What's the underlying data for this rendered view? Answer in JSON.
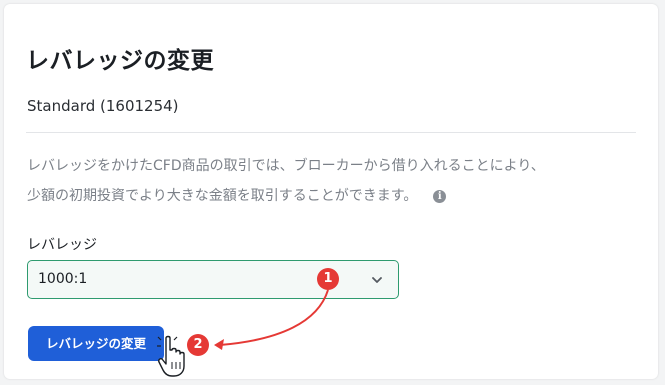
{
  "dialog": {
    "title": "レバレッジの変更",
    "account": "Standard (1601254)",
    "description_line1": "レバレッジをかけたCFD商品の取引では、ブローカーから借り入れることにより、",
    "description_line2": "少額の初期投資でより大きな金額を取引することができます。",
    "info_icon": "info-icon",
    "leverage_label": "レバレッジ",
    "leverage_value": "1000:1",
    "submit_label": "レバレッジの変更"
  },
  "annotations": {
    "step1": "1",
    "step2": "2",
    "color": "#e53935"
  },
  "colors": {
    "primary": "#1f5fd8",
    "select_border": "#2e9b6f"
  }
}
